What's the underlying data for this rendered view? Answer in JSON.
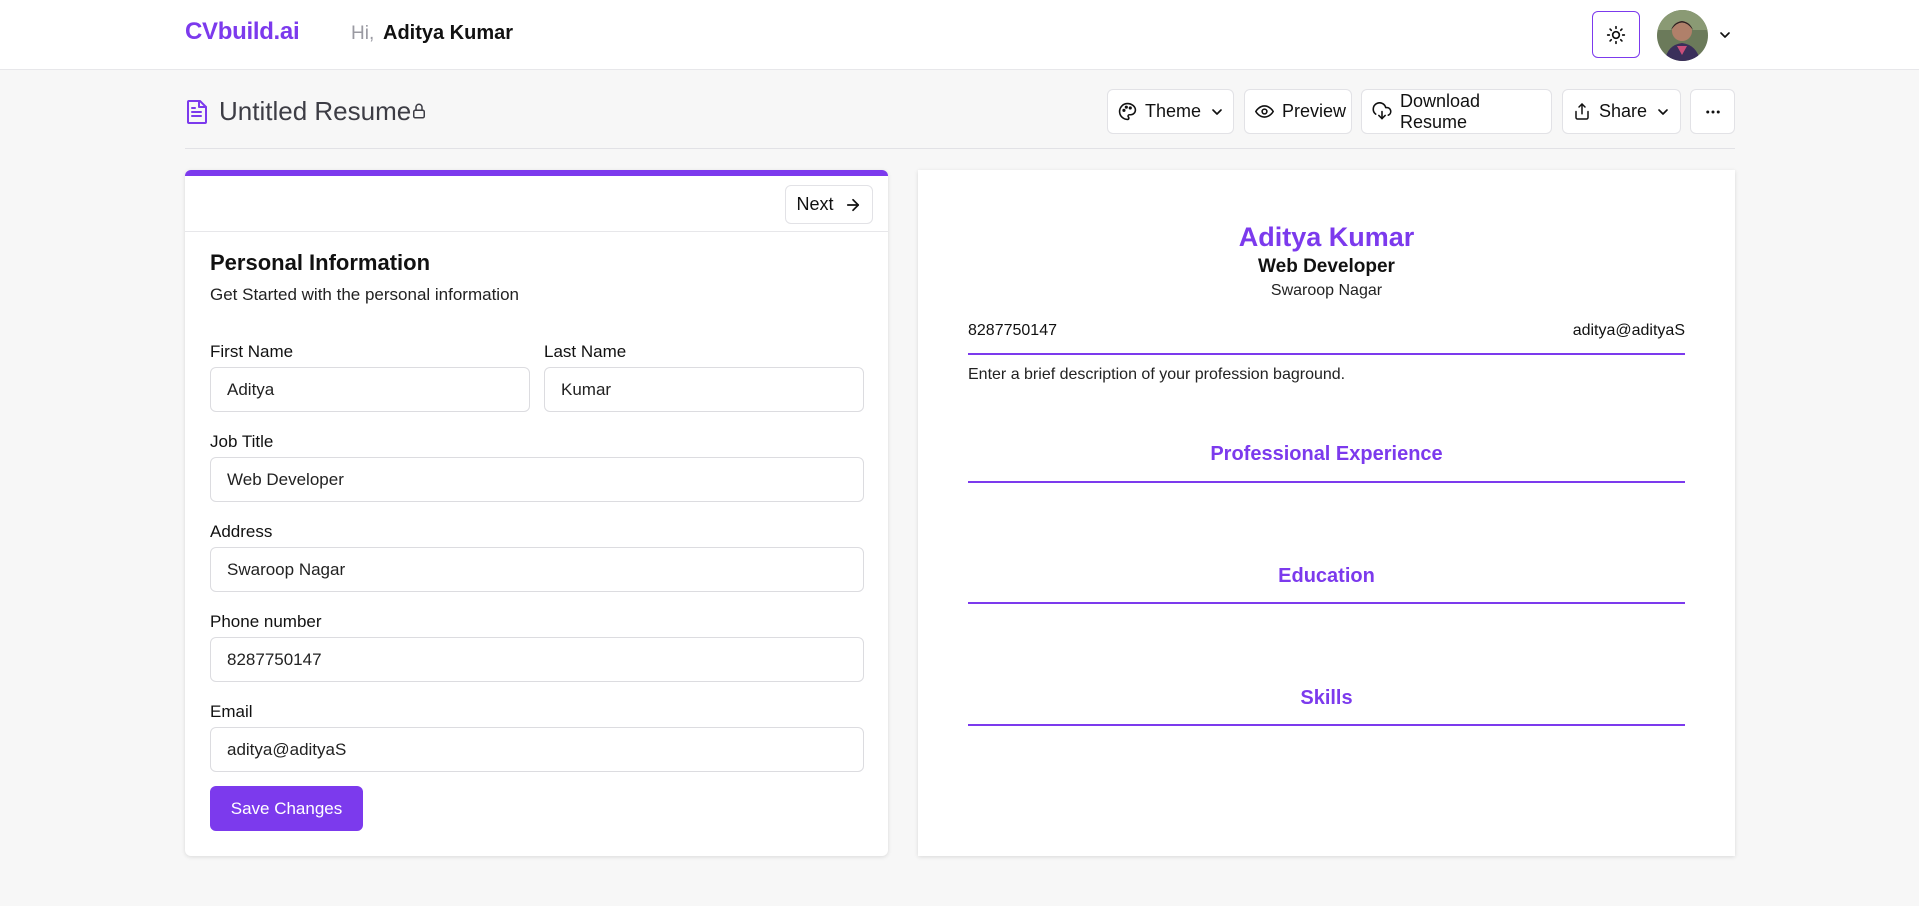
{
  "header": {
    "logo": "CVbuild.ai",
    "greeting": "Hi,",
    "user_name": "Aditya Kumar"
  },
  "toolbar": {
    "doc_title": "Untitled Resume",
    "theme_label": "Theme",
    "preview_label": "Preview",
    "download_label": "Download Resume",
    "share_label": "Share",
    "more_label": "..."
  },
  "form": {
    "next_label": "Next",
    "title": "Personal Information",
    "subtitle": "Get Started with the personal information",
    "fields": {
      "first_name": {
        "label": "First Name",
        "value": "Aditya"
      },
      "last_name": {
        "label": "Last Name",
        "value": "Kumar"
      },
      "job_title": {
        "label": "Job Title",
        "value": "Web Developer"
      },
      "address": {
        "label": "Address",
        "value": "Swaroop Nagar"
      },
      "phone": {
        "label": "Phone number",
        "value": "8287750147"
      },
      "email": {
        "label": "Email",
        "value": "aditya@adityaS"
      }
    },
    "save_label": "Save Changes"
  },
  "preview": {
    "name": "Aditya Kumar",
    "job_title": "Web Developer",
    "address": "Swaroop Nagar",
    "phone": "8287750147",
    "email": "aditya@adityaS",
    "summary": "Enter a brief description of your profession baground.",
    "sections": [
      "Professional Experience",
      "Education",
      "Skills"
    ]
  },
  "colors": {
    "accent": "#7c3aed",
    "background": "#f7f7f7",
    "surface": "#ffffff",
    "border": "#e2e2e6"
  },
  "icons": [
    "sun-icon",
    "chevron-down-icon",
    "document-icon",
    "lock-icon",
    "palette-icon",
    "eye-icon",
    "cloud-download-icon",
    "share-icon",
    "more-horizontal-icon",
    "arrow-right-icon"
  ]
}
